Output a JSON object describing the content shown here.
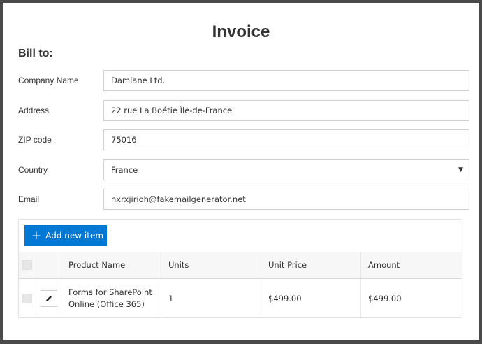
{
  "title": "Invoice",
  "bill_to": "Bill to:",
  "form": {
    "company": {
      "label": "Company Name",
      "value": "Damiane Ltd."
    },
    "address": {
      "label": "Address",
      "value": "22 rue La Boétie Île-de-France"
    },
    "zip": {
      "label": "ZIP code",
      "value": "75016"
    },
    "country": {
      "label": "Country",
      "value": "France"
    },
    "email": {
      "label": "Email",
      "value": "nxrxjirioh@fakemailgenerator.net"
    }
  },
  "items": {
    "add_label": "Add new item",
    "columns": [
      "Product Name",
      "Units",
      "Unit Price",
      "Amount"
    ],
    "rows": [
      {
        "product_line1": "Forms for SharePoint",
        "product_line2": "Online (Office 365)",
        "units": "1",
        "unit_price": "$499.00",
        "amount": "$499.00"
      }
    ]
  },
  "icons": {
    "add": "plus-icon",
    "edit": "pencil-icon",
    "dropdown": "chevron-down-icon"
  },
  "colors": {
    "accent": "#0078d4"
  }
}
